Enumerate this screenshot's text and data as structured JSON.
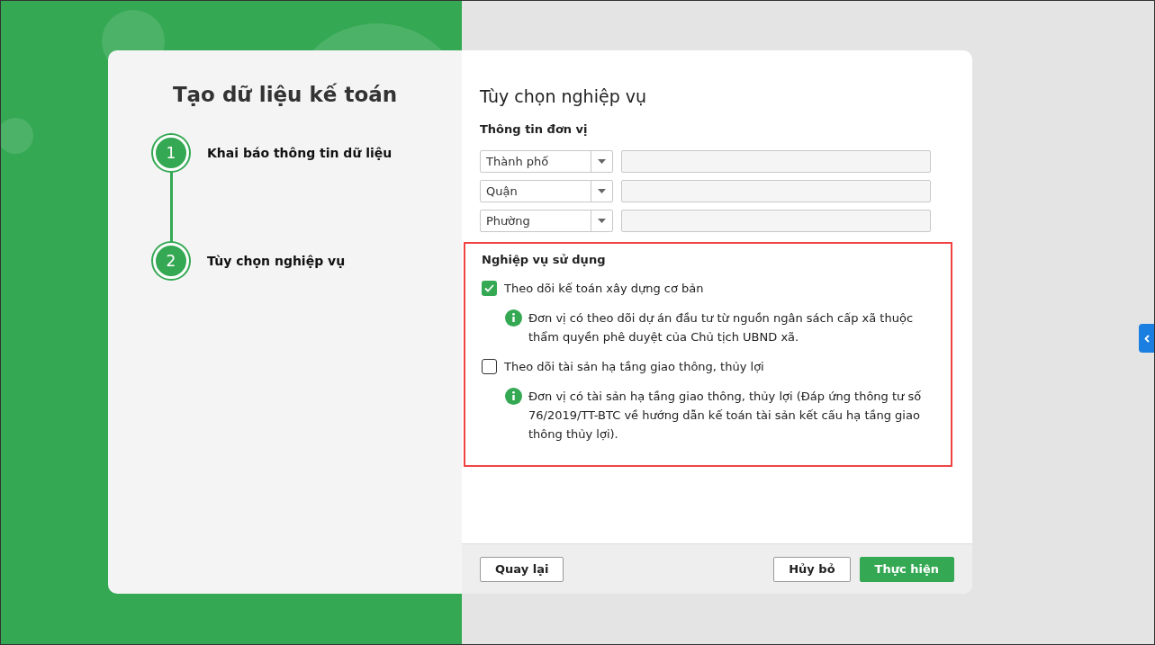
{
  "wizard": {
    "title": "Tạo dữ liệu kế toán",
    "steps": [
      {
        "number": "1",
        "label": "Khai báo thông tin dữ liệu"
      },
      {
        "number": "2",
        "label": "Tùy chọn nghiệp vụ"
      }
    ]
  },
  "panel": {
    "title": "Tùy chọn nghiệp vụ",
    "unit_info": {
      "heading": "Thông tin đơn vị",
      "rows": [
        {
          "select": "Thành phố"
        },
        {
          "select": "Quận"
        },
        {
          "select": "Phường"
        }
      ]
    },
    "features": {
      "heading": "Nghiệp vụ sử dụng",
      "highlighted": true,
      "options": [
        {
          "label": "Theo dõi kế toán xây dựng cơ bản",
          "checked": true,
          "note": "Đơn vị có theo dõi dự án đầu tư từ nguồn ngân sách cấp xã thuộc thẩm quyền phê duyệt của Chủ tịch UBND xã."
        },
        {
          "label": "Theo dõi tài sản hạ tầng giao thông, thủy lợi",
          "checked": false,
          "note": "Đơn vị có tài sản hạ tầng giao thông, thủy lợi (Đáp ứng thông tư số 76/2019/TT-BTC về hướng dẫn kế toán tài sản kết cấu hạ tầng giao thông thủy lợi)."
        }
      ]
    }
  },
  "footer": {
    "buttons": [
      {
        "label": "Quay lại",
        "kind": "secondary"
      },
      {
        "label": "Hủy bỏ",
        "kind": "secondary"
      },
      {
        "label": "Thực hiện",
        "kind": "primary"
      }
    ]
  }
}
